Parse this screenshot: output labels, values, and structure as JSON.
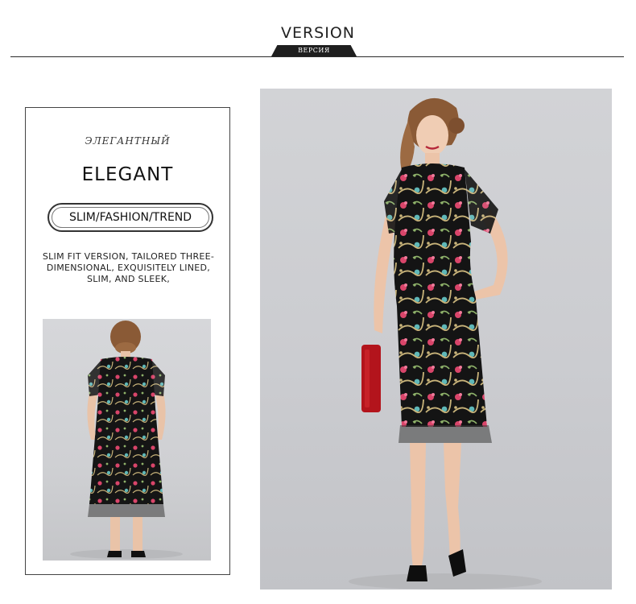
{
  "header": {
    "title": "VERSION",
    "tag": "ВЕРСИЯ"
  },
  "left_panel": {
    "subtitle": "ЭЛЕГАНТНЫЙ",
    "title": "ELEGANT",
    "pill": "SLIM/FASHION/TREND",
    "description_lines": [
      "SLIM FIT VERSION, TAILORED THREE-",
      "DIMENSIONAL, EXQUISITELY LINED,",
      "SLIM, AND SLEEK,"
    ],
    "photo": "back-view-model-photo"
  },
  "main_photo": "front-view-model-photo",
  "colors": {
    "background": "#ffffff",
    "rule": "#2a2a2a",
    "tag_bg": "#1f1f1f",
    "photo_bg": "#cfd0d3",
    "dress_black": "#141414",
    "embroidery_pink": "#d9456a",
    "embroidery_teal": "#5fb8b8",
    "embroidery_gold": "#c9b47a",
    "bag_red": "#b3141c"
  }
}
